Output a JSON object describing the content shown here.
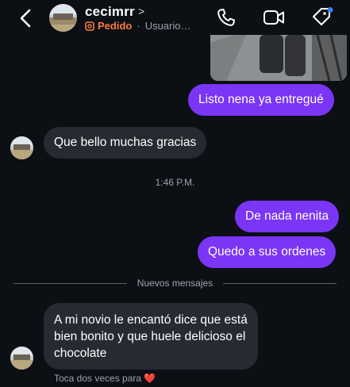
{
  "header": {
    "contact_name": "cecimrr",
    "name_chevron": ">",
    "status_tag": "Pedido",
    "status_separator": "·",
    "status_text": "Usuario…",
    "back_icon": "chevron-left-icon",
    "call_icon": "phone-icon",
    "video_icon": "video-camera-icon",
    "tag_icon": "tag-icon",
    "accent_color": "#ff7a3d"
  },
  "messages": [
    {
      "from": "me",
      "text": "Listo nena ya entregué"
    },
    {
      "from": "them",
      "text": "Que bello muchas gracias"
    },
    {
      "from": "me",
      "text": "De nada nenita"
    },
    {
      "from": "me",
      "text": "Quedo a sus ordenes"
    },
    {
      "from": "them",
      "lines": [
        "A mi novio le encantó dice que está",
        "bien bonito y que huele delicioso el",
        "chocolate"
      ]
    }
  ],
  "timestamp": "1:46 P.M.",
  "divider_label": "Nuevos mensajes",
  "reaction_hint": {
    "text": "Toca dos veces para",
    "emoji": "❤️"
  },
  "colors": {
    "outgoing_bubble": "#7a35f5",
    "incoming_bubble": "#262a31",
    "background": "#0c0f14",
    "notification_dot": "#3b82f6"
  }
}
